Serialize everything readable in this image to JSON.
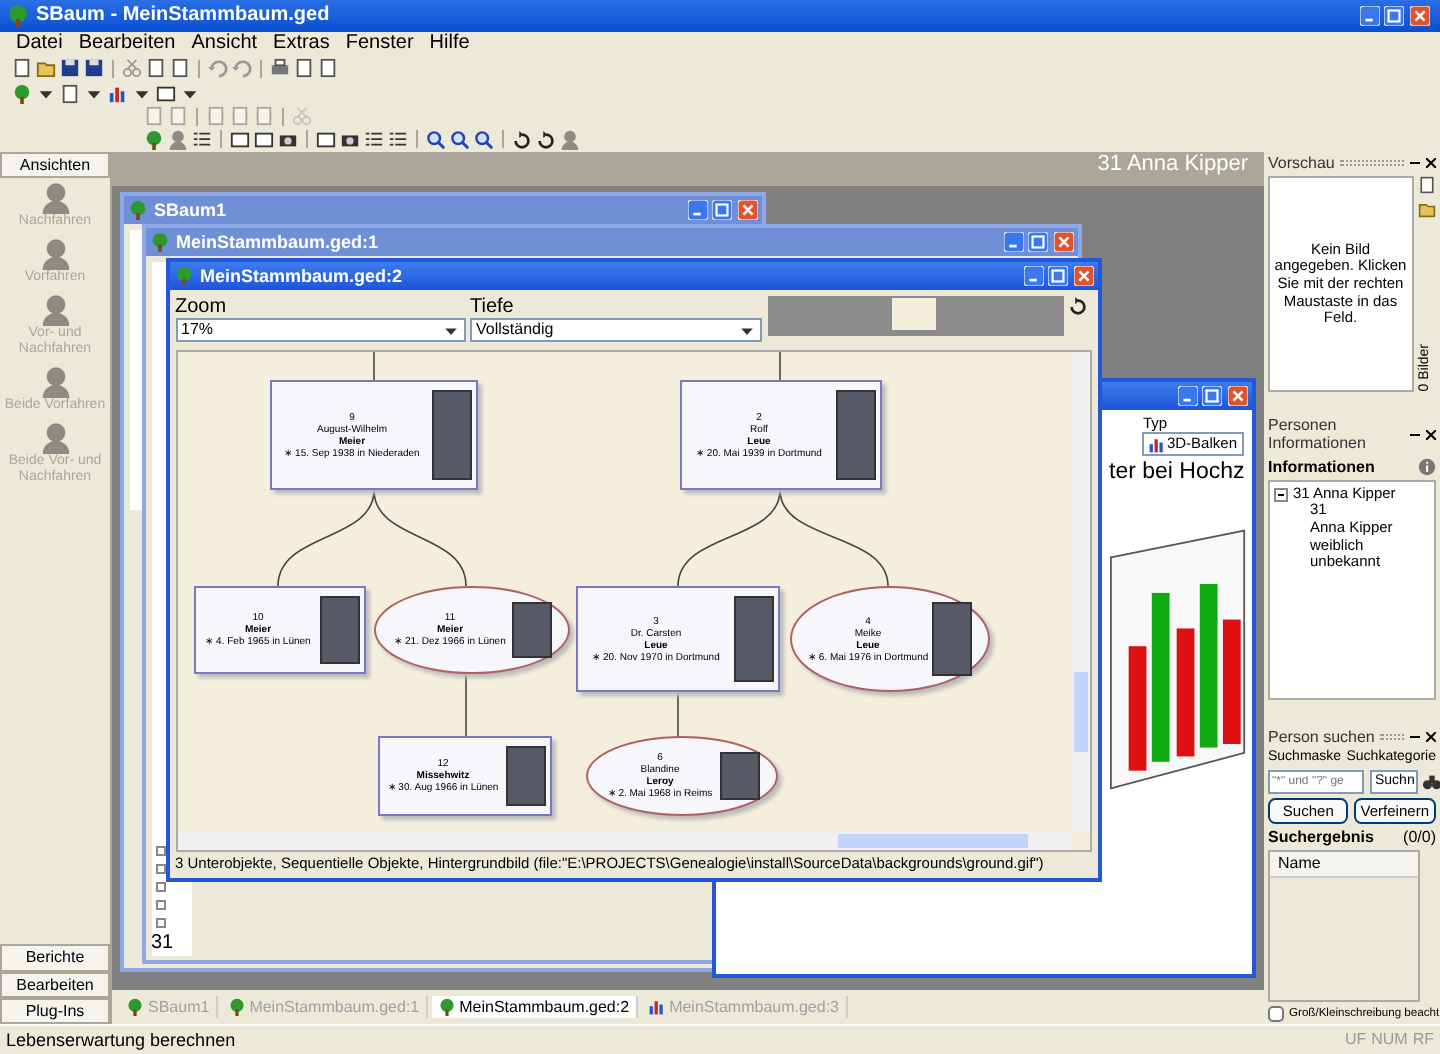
{
  "window": {
    "title": "SBaum - MeinStammbaum.ged"
  },
  "menu": [
    "Datei",
    "Bearbeiten",
    "Ansicht",
    "Extras",
    "Fenster",
    "Hilfe"
  ],
  "sidebar": {
    "title": "Ansichten",
    "items": [
      {
        "label": "Nachfahren",
        "disabled": true
      },
      {
        "label": "Vorfahren",
        "disabled": true
      },
      {
        "label": "Vor- und Nachfahren",
        "disabled": true
      },
      {
        "label": "Beide Vorfahren",
        "disabled": true
      },
      {
        "label": "Beide Vor- und Nachfahren",
        "disabled": true
      }
    ],
    "sections": [
      "Berichte",
      "Bearbeiten",
      "Plug-Ins"
    ]
  },
  "workspace": {
    "header": "31 Anna Kipper"
  },
  "back_windows": [
    {
      "title": "SBaum1"
    },
    {
      "title": "MeinStammbaum.ged:1",
      "footer": "31"
    }
  ],
  "chart_window": {
    "heading": "ter bei Hochz",
    "type_label": "Typ",
    "type_value": "3D-Balken"
  },
  "tree_window": {
    "title": "MeinStammbaum.ged:2",
    "zoom_label": "Zoom",
    "zoom_value": "17%",
    "depth_label": "Tiefe",
    "depth_value": "Vollständig",
    "persons": [
      {
        "kind": "box",
        "number": "9",
        "given": "August-Wilhelm",
        "surname": "Meier",
        "birth": "∗ 15. Sep 1938 in Niederaden"
      },
      {
        "kind": "box",
        "number": "2",
        "given": "Rolf",
        "surname": "Leue",
        "birth": "∗ 20. Mai 1939 in Dortmund"
      },
      {
        "kind": "box",
        "number": "10",
        "surname": "Meier",
        "birth": "∗ 4. Feb 1965 in Lünen"
      },
      {
        "kind": "oval",
        "number": "11",
        "surname": "Meier",
        "birth": "∗ 21. Dez 1966 in Lünen"
      },
      {
        "kind": "box",
        "number": "3",
        "given": "Dr. Carsten",
        "surname": "Leue",
        "birth": "∗ 20. Nov 1970 in Dortmund"
      },
      {
        "kind": "oval",
        "number": "4",
        "given": "Meike",
        "surname": "Leue",
        "birth": "∗ 6. Mai 1976 in Dortmund"
      },
      {
        "kind": "box",
        "number": "12",
        "surname": "Missehwitz",
        "birth": "∗ 30. Aug 1966 in Lünen"
      },
      {
        "kind": "oval",
        "number": "6",
        "given": "Blandine",
        "surname": "Leroy",
        "birth": "∗ 2. Mai 1968 in Reims"
      }
    ],
    "status": "3 Unterobjekte, Sequentielle Objekte, Hintergrundbild (file:\"E:\\PROJECTS\\Genealogie\\install\\SourceData\\backgrounds\\ground.gif\")"
  },
  "doc_tabs": [
    {
      "label": "SBaum1",
      "selected": false
    },
    {
      "label": "MeinStammbaum.ged:1",
      "selected": false
    },
    {
      "label": "MeinStammbaum.ged:2",
      "selected": true
    },
    {
      "label": "MeinStammbaum.ged:3",
      "selected": false
    }
  ],
  "preview": {
    "title": "Vorschau",
    "message": "Kein Bild angegeben. Klicken Sie mit der rechten Maustaste in das Feld.",
    "side_label": "0 Bilder"
  },
  "person_info": {
    "title": "Personen Informationen",
    "heading": "Informationen",
    "tree": [
      {
        "label": "31 Anna Kipper",
        "expanded": true,
        "children": [
          {
            "label": "31"
          },
          {
            "label": "Anna Kipper"
          },
          {
            "label": "weiblich"
          },
          {
            "label": "unbekannt"
          }
        ]
      }
    ]
  },
  "search": {
    "title": "Person suchen",
    "mask_label": "Suchmaske",
    "category_label": "Suchkategorie",
    "mask_placeholder": "\"*\" und \"?\" ge",
    "category_value": "Suchn",
    "buttons": [
      "Suchen",
      "Verfeinern"
    ],
    "results_label": "Suchergebnis",
    "results_count": "(0/0)",
    "column": "Name",
    "case_label": "Groß/Kleinschreibung beacht",
    "case_checked": false
  },
  "status_bar": {
    "text": "Lebenserwartung berechnen",
    "indicators": [
      "UF",
      "NUM",
      "RF"
    ]
  }
}
